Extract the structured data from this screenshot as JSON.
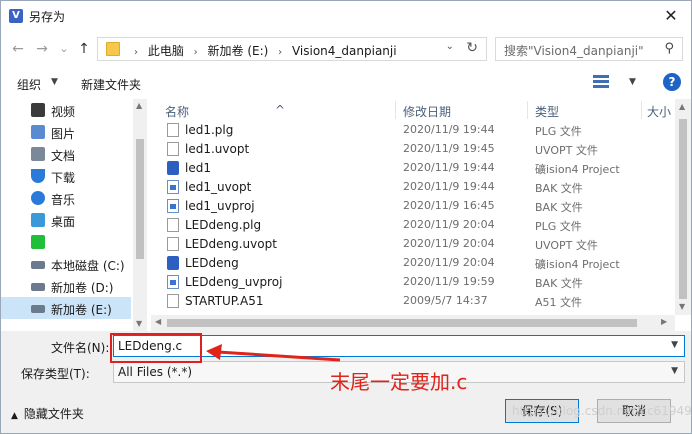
{
  "window": {
    "title": "另存为",
    "close_glyph": "✕"
  },
  "nav": {
    "back_glyph": "←",
    "forward_glyph": "→",
    "dropdown_glyph": "⌄",
    "up_glyph": "↑",
    "breadcrumbs": [
      "此电脑",
      "新加卷 (E:)",
      "Vision4_danpianji"
    ],
    "separator": "›",
    "refresh_glyph": "↻",
    "search_placeholder": "搜索\"Vision4_danpianji\"",
    "search_glyph": "⚲"
  },
  "toolbar": {
    "organize": "组织",
    "new_folder": "新建文件夹",
    "help": "?"
  },
  "sidebar": {
    "items": [
      {
        "label": "视频",
        "color": "#3b3b3b"
      },
      {
        "label": "图片",
        "color": "#5a8bd1"
      },
      {
        "label": "文档",
        "color": "#7a8898"
      },
      {
        "label": "下载",
        "color": "#2a7ad9"
      },
      {
        "label": "音乐",
        "color": "#2a7ad9"
      },
      {
        "label": "桌面",
        "color": "#3a9ad9"
      },
      {
        "label": "",
        "color": "#1fbf3a"
      },
      {
        "label": "本地磁盘 (C:)",
        "color": "#6b7a8c"
      },
      {
        "label": "新加卷 (D:)",
        "color": "#6b7a8c"
      },
      {
        "label": "新加卷 (E:)",
        "color": "#6b7a8c"
      }
    ]
  },
  "columns": {
    "name": "名称",
    "date": "修改日期",
    "type": "类型",
    "size": "大小"
  },
  "files": [
    {
      "name": "led1.plg",
      "date": "2020/11/9 19:44",
      "type": "PLG 文件",
      "icon": "plain"
    },
    {
      "name": "led1.uvopt",
      "date": "2020/11/9 19:45",
      "type": "UVOPT 文件",
      "icon": "plain"
    },
    {
      "name": "led1",
      "date": "2020/11/9 19:44",
      "type": "礦ision4 Project",
      "icon": "uv"
    },
    {
      "name": "led1_uvopt",
      "date": "2020/11/9 19:44",
      "type": "BAK 文件",
      "icon": "bak"
    },
    {
      "name": "led1_uvproj",
      "date": "2020/11/9 16:45",
      "type": "BAK 文件",
      "icon": "bak"
    },
    {
      "name": "LEDdeng.plg",
      "date": "2020/11/9 20:04",
      "type": "PLG 文件",
      "icon": "plain"
    },
    {
      "name": "LEDdeng.uvopt",
      "date": "2020/11/9 20:04",
      "type": "UVOPT 文件",
      "icon": "plain"
    },
    {
      "name": "LEDdeng",
      "date": "2020/11/9 20:04",
      "type": "礦ision4 Project",
      "icon": "uv"
    },
    {
      "name": "LEDdeng_uvproj",
      "date": "2020/11/9 19:59",
      "type": "BAK 文件",
      "icon": "bak"
    },
    {
      "name": "STARTUP.A51",
      "date": "2009/5/7 14:37",
      "type": "A51 文件",
      "icon": "plain"
    }
  ],
  "form": {
    "filename_label": "文件名(N):",
    "filename_value": "LEDdeng.c",
    "filetype_label": "保存类型(T):",
    "filetype_value": "All Files (*.*)",
    "hide_folders": "隐藏文件夹",
    "save": "保存(S)",
    "cancel": "取消"
  },
  "annotation": {
    "text": "末尾一定要加.c",
    "color": "#e0241a"
  },
  "watermark": "https://blog.csdn.net/cc61949"
}
